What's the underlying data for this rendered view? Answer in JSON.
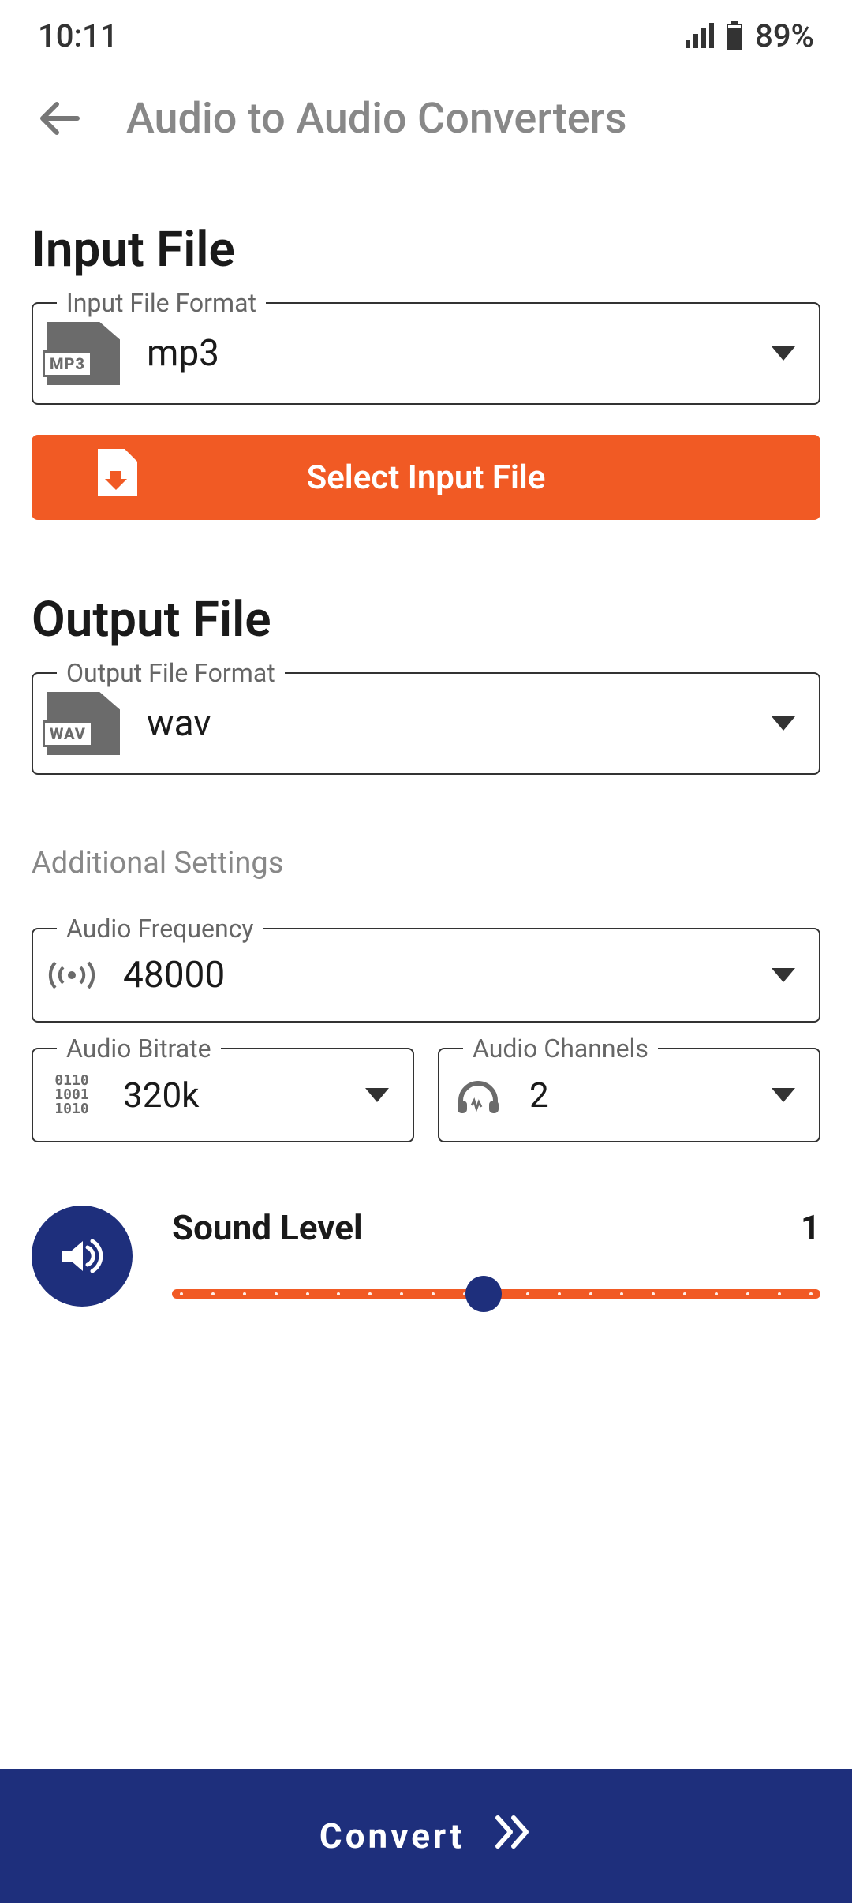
{
  "status": {
    "time": "10:11",
    "battery_pct": "89%"
  },
  "header": {
    "title": "Audio to Audio Converters"
  },
  "input": {
    "section_title": "Input File",
    "format_legend": "Input File Format",
    "format_value": "mp3",
    "format_icon_tag": "MP3",
    "select_button_label": "Select Input File"
  },
  "output": {
    "section_title": "Output File",
    "format_legend": "Output File Format",
    "format_value": "wav",
    "format_icon_tag": "WAV"
  },
  "settings": {
    "additional_label": "Additional Settings",
    "frequency": {
      "legend": "Audio Frequency",
      "value": "48000"
    },
    "bitrate": {
      "legend": "Audio Bitrate",
      "value": "320k"
    },
    "channels": {
      "legend": "Audio Channels",
      "value": "2"
    }
  },
  "sound": {
    "label": "Sound Level",
    "value": "1"
  },
  "footer": {
    "convert_label": "Convert"
  },
  "colors": {
    "accent_orange": "#f15a24",
    "accent_navy": "#1e2f7c"
  }
}
